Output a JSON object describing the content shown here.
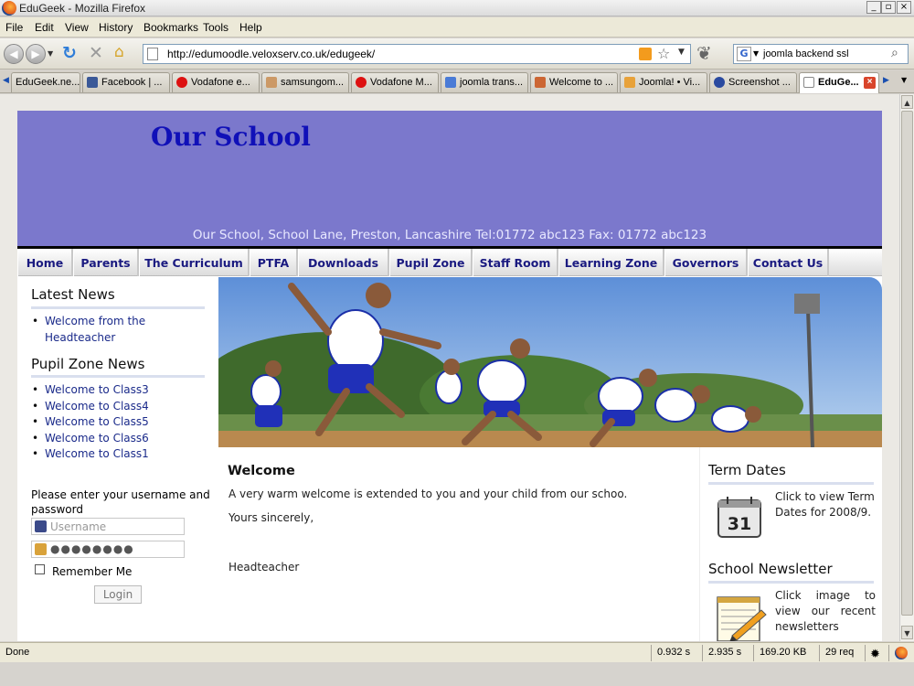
{
  "window": {
    "title": "EduGeek - Mozilla Firefox"
  },
  "menu": [
    "File",
    "Edit",
    "View",
    "History",
    "Bookmarks",
    "Tools",
    "Help"
  ],
  "toolbar": {
    "url": "http://edumoodle.veloxserv.co.uk/edugeek/",
    "search_value": "joomla backend ssl"
  },
  "tabs": [
    {
      "label": "EduGeek.ne...",
      "icon_color": "#3a6fc4"
    },
    {
      "label": "Facebook | ...",
      "icon_color": "#3b5998"
    },
    {
      "label": "Vodafone e...",
      "icon_color": "#d11"
    },
    {
      "label": "samsungom...",
      "icon_color": "#c96"
    },
    {
      "label": "Vodafone M...",
      "icon_color": "#d11"
    },
    {
      "label": "joomla trans...",
      "icon_color": "#4a7bd6"
    },
    {
      "label": "Welcome to ...",
      "icon_color": "#c63"
    },
    {
      "label": "Joomla! • Vi...",
      "icon_color": "#e8a23a"
    },
    {
      "label": "Screenshot ...",
      "icon_color": "#2a4aa0"
    },
    {
      "label": "EduGe...",
      "icon_color": "#ffffff",
      "active": true
    }
  ],
  "site": {
    "title": "Our School",
    "address": "Our School, School Lane, Preston, Lancashire Tel:01772 abc123 Fax: 01772 abc123",
    "nav": [
      "Home",
      "Parents",
      "The Curriculum",
      "PTFA",
      "Downloads",
      "Pupil Zone",
      "Staff Room",
      "Learning Zone",
      "Governors",
      "Contact Us"
    ],
    "latest_news": {
      "title": "Latest News",
      "items": [
        "Welcome from the Headteacher"
      ]
    },
    "pupil_zone_news": {
      "title": "Pupil Zone News",
      "items": [
        "Welcome to Class3",
        "Welcome to Class4",
        "Welcome to Class5",
        "Welcome to Class6",
        "Welcome to Class1"
      ]
    },
    "login": {
      "prompt": "Please enter your username and password",
      "username_placeholder": "Username",
      "password_mask": "●●●●●●●●",
      "remember_label": "Remember Me",
      "button_label": "Login"
    },
    "welcome": {
      "title": "Welcome",
      "body": "A very warm welcome is extended to you and your child from our schoo.",
      "sincerely": "Yours sincerely,",
      "signoff": "Headteacher"
    },
    "term_dates": {
      "title": "Term Dates",
      "calendar_day": "31",
      "text": "Click to view Term Dates for 2008/9."
    },
    "newsletter": {
      "title": "School Newsletter",
      "text": "Click image to view our recent newsletters"
    }
  },
  "status": {
    "text": "Done",
    "time1": "0.932 s",
    "time2": "2.935 s",
    "size": "169.20 KB",
    "requests": "29 req"
  }
}
